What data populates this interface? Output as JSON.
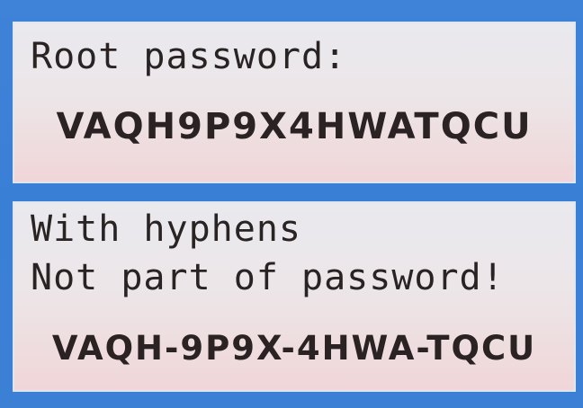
{
  "root_panel": {
    "label": "Root password:",
    "password": "VAQH9P9X4HWATQCU"
  },
  "hyphen_panel": {
    "line1": "With hyphens",
    "line2": "Not part of password!",
    "password_hyphenated": "VAQH-9P9X-4HWA-TQCU"
  },
  "colors": {
    "screen_background": "#3c80d6",
    "panel_background_top": "#e9e9ee",
    "panel_background_bottom": "#f0d6d8",
    "text": "#2a2324"
  }
}
